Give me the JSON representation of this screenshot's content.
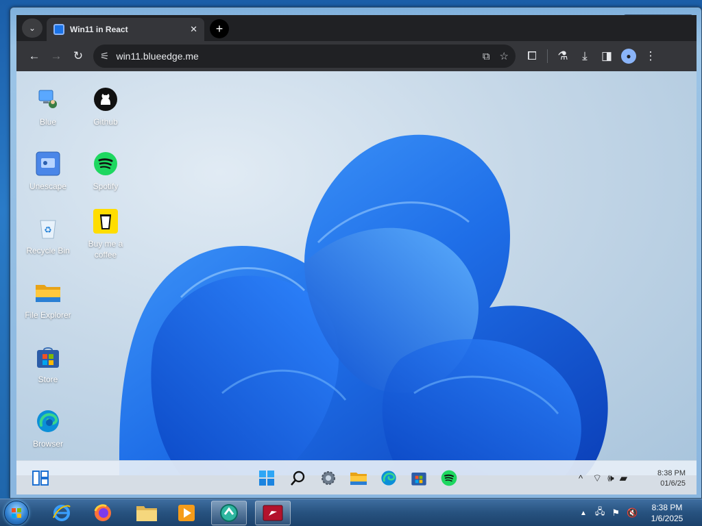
{
  "browser": {
    "tab_title": "Win11 in React",
    "tab_close": "✕",
    "new_tab": "+",
    "url": "win11.blueedge.me"
  },
  "win7_window": {
    "minimize": "—",
    "maximize": "▫",
    "close": "✕"
  },
  "desktop_icons": [
    {
      "label": "Blue",
      "icon": "computer-icon"
    },
    {
      "label": "Github",
      "icon": "github-icon"
    },
    {
      "label": "Unescape",
      "icon": "unescape-icon"
    },
    {
      "label": "Spotify",
      "icon": "spotify-icon"
    },
    {
      "label": "Recycle Bin",
      "icon": "recycle-bin-icon"
    },
    {
      "label": "Buy me a coffee",
      "icon": "coffee-icon"
    },
    {
      "label": "File Explorer",
      "icon": "folder-icon"
    },
    {
      "label": "Store",
      "icon": "store-icon"
    },
    {
      "label": "Browser",
      "icon": "edge-icon"
    }
  ],
  "win11_taskbar": {
    "time": "8:38 PM",
    "date": "01/6/25",
    "tray_chevron": "^"
  },
  "win7_taskbar": {
    "time": "8:38 PM",
    "date": "1/6/2025"
  },
  "colors": {
    "accent": "#1a73e8",
    "bloom": "#1f6fe8",
    "spotify": "#1ed760"
  }
}
